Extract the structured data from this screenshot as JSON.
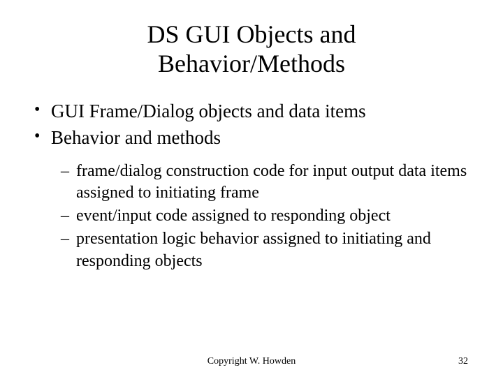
{
  "title_line1": "DS GUI Objects and",
  "title_line2": "Behavior/Methods",
  "bullets": [
    "GUI Frame/Dialog objects and data items",
    "Behavior and methods"
  ],
  "sub_bullets": [
    "frame/dialog construction code for input output data items assigned to initiating frame",
    "event/input code assigned to responding object",
    "presentation logic behavior assigned to initiating and responding objects"
  ],
  "copyright": "Copyright W. Howden",
  "page_number": "32"
}
